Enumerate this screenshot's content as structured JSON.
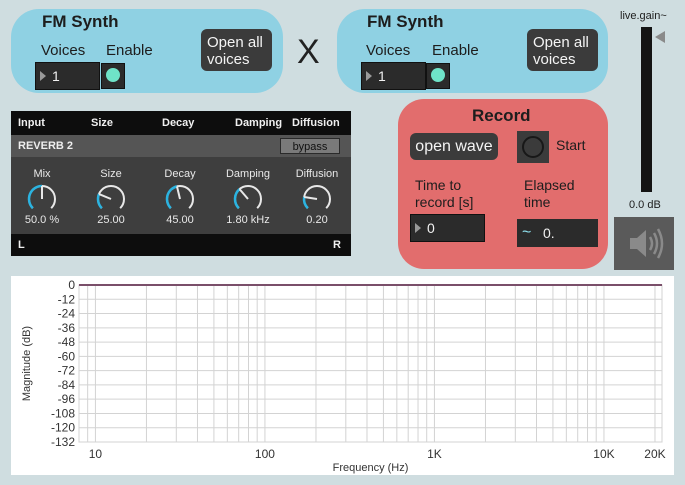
{
  "fm_left": {
    "title": "FM Synth",
    "voices_label": "Voices",
    "enable_label": "Enable",
    "voices_value": "1",
    "open_button": [
      "Open all",
      "voices"
    ]
  },
  "multiply_symbol": "X",
  "fm_right": {
    "title": "FM Synth",
    "voices_label": "Voices",
    "enable_label": "Enable",
    "voices_value": "1",
    "open_button": [
      "Open all",
      "voices"
    ]
  },
  "reverb": {
    "header": [
      "Input",
      "Size",
      "Decay",
      "Damping",
      "Diffusion"
    ],
    "name": "REVERB 2",
    "bypass_label": "bypass",
    "knobs": [
      {
        "label": "Mix",
        "value": "50.0 %",
        "level": 0.5
      },
      {
        "label": "Size",
        "value": "25.00",
        "level": 0.25
      },
      {
        "label": "Decay",
        "value": "45.00",
        "level": 0.45
      },
      {
        "label": "Damping",
        "value": "1.80 kHz",
        "level": 0.35
      },
      {
        "label": "Diffusion",
        "value": "0.20",
        "level": 0.2
      }
    ],
    "left_channel": "L",
    "right_channel": "R"
  },
  "record": {
    "title": "Record",
    "open_wave_label": "open wave",
    "start_label": "Start",
    "time_label": [
      "Time to",
      "record [s]"
    ],
    "time_value": "0",
    "elapsed_label": [
      "Elapsed",
      "time"
    ],
    "elapsed_value": "0."
  },
  "gain": {
    "label": "live.gain~",
    "value": "0.0 dB",
    "speaker_icon": "speaker-icon"
  },
  "colors": {
    "fm_panel": "#8fd1e3",
    "record_panel": "#e26d6d",
    "toggle_on": "#6fe3c8",
    "trace": "#7a4f6a"
  },
  "chart_data": {
    "type": "line",
    "xlabel": "Frequency (Hz)",
    "ylabel": "Magnitude (dB)",
    "xscale": "log",
    "xlim": [
      8,
      22000
    ],
    "ylim": [
      -132,
      0
    ],
    "x_ticks": [
      10,
      100,
      1000,
      10000,
      20000
    ],
    "x_tick_labels": [
      "10",
      "100",
      "1K",
      "10K",
      "20K"
    ],
    "y_ticks": [
      0,
      -12,
      -24,
      -36,
      -48,
      -60,
      -72,
      -84,
      -96,
      -108,
      -120,
      -132
    ],
    "y_tick_labels": [
      "0",
      "-12",
      "-24",
      "-36",
      "-48",
      "-60",
      "-72",
      "-84",
      "-96",
      "-108",
      "-120",
      "-132"
    ],
    "grid": true,
    "series": [
      {
        "x": [
          8,
          22000
        ],
        "y": [
          0,
          0
        ]
      }
    ]
  }
}
